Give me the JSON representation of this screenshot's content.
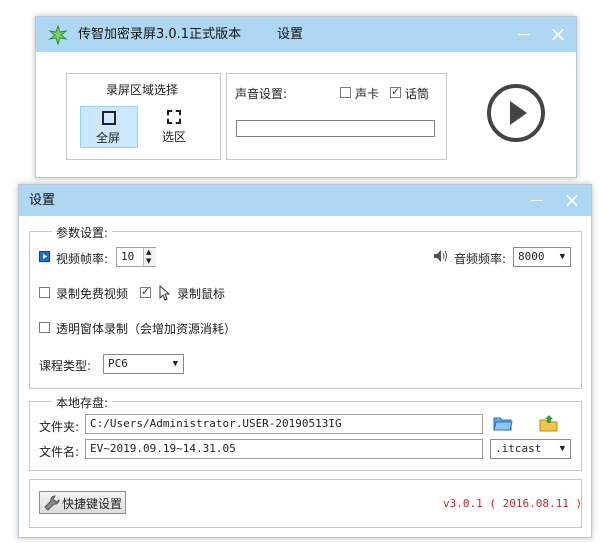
{
  "recorder": {
    "title": "传智加密录屏3.0.1正式版本",
    "settings_label": "设置",
    "minimize": "—",
    "close": "×",
    "area_group_title": "录屏区域选择",
    "fullscreen_label": "全屏",
    "selection_label": "选区",
    "sound_settings_label": "声音设置:",
    "soundcard_label": "声卡",
    "soundcard_checked": false,
    "microphone_label": "话筒",
    "microphone_checked": true,
    "volume_meter_value": ""
  },
  "settings": {
    "title": "设置",
    "minimize": "—",
    "close": "×",
    "params_group": "参数设置:",
    "frame_rate_label": "视频帧率:",
    "frame_rate_value": "10",
    "sample_rate_label": "音频频率:",
    "sample_rate_value": "8000",
    "free_video_label": "录制免费视频",
    "free_video_checked": false,
    "record_mouse_label": "录制鼠标",
    "record_mouse_checked": true,
    "transparent_label": "透明窗体录制（会增加资源消耗）",
    "transparent_checked": false,
    "course_type_label": "课程类型:",
    "course_type_value": "PC6",
    "storage_group": "本地存盘:",
    "folder_label": "文件夹:",
    "folder_value": "C:/Users/Administrator.USER-20190513IG",
    "filename_label": "文件名:",
    "filename_value": "EV~2019.09.19~14.31.05",
    "extension_value": ".itcast",
    "hotkey_button": "快捷键设置",
    "version_text": "v3.0.1 ( 2016.08.11 )"
  },
  "colors": {
    "titlebar": "#aed7f4",
    "accent_red": "#c0282a",
    "highlight": "#cce8ff"
  }
}
